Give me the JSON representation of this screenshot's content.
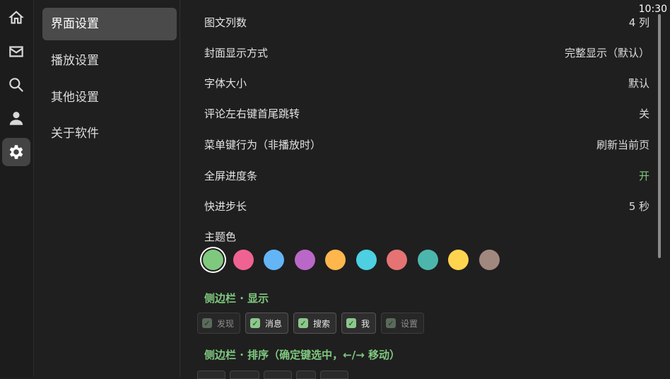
{
  "status": {
    "time": "10:30"
  },
  "rail": {
    "items": [
      {
        "icon": "home-icon",
        "active": false
      },
      {
        "icon": "mail-icon",
        "active": false
      },
      {
        "icon": "search-icon",
        "active": false
      },
      {
        "icon": "person-icon",
        "active": false
      },
      {
        "icon": "gear-icon",
        "active": true
      }
    ]
  },
  "menu": {
    "items": [
      {
        "label": "界面设置",
        "active": true
      },
      {
        "label": "播放设置",
        "active": false
      },
      {
        "label": "其他设置",
        "active": false
      },
      {
        "label": "关于软件",
        "active": false
      }
    ]
  },
  "settings": {
    "rows": [
      {
        "label": "图文列数",
        "value": "4 列"
      },
      {
        "label": "封面显示方式",
        "value": "完整显示（默认）"
      },
      {
        "label": "字体大小",
        "value": "默认"
      },
      {
        "label": "评论左右键首尾跳转",
        "value": "关"
      },
      {
        "label": "菜单键行为（非播放时）",
        "value": "刷新当前页"
      },
      {
        "label": "全屏进度条",
        "value": "开"
      },
      {
        "label": "快进步长",
        "value": "5 秒"
      }
    ],
    "theme_label": "主题色",
    "theme_colors": [
      "#7fc97f",
      "#f06292",
      "#64b5f6",
      "#ba68c8",
      "#ffb74d",
      "#4dd0e1",
      "#e57373",
      "#4db6ac",
      "#ffd54f",
      "#a1887f"
    ],
    "theme_selected": 0,
    "accent": "#7fc97f"
  },
  "sidebar_display": {
    "title": "侧边栏 · 显示",
    "chips": [
      {
        "label": "发现",
        "checked": true,
        "dim": true
      },
      {
        "label": "消息",
        "checked": true,
        "dim": false
      },
      {
        "label": "搜索",
        "checked": true,
        "dim": false
      },
      {
        "label": "我",
        "checked": true,
        "dim": false
      },
      {
        "label": "设置",
        "checked": true,
        "dim": true
      }
    ]
  },
  "sidebar_order": {
    "title": "侧边栏 · 排序（确定键选中，←/→ 移动）"
  }
}
